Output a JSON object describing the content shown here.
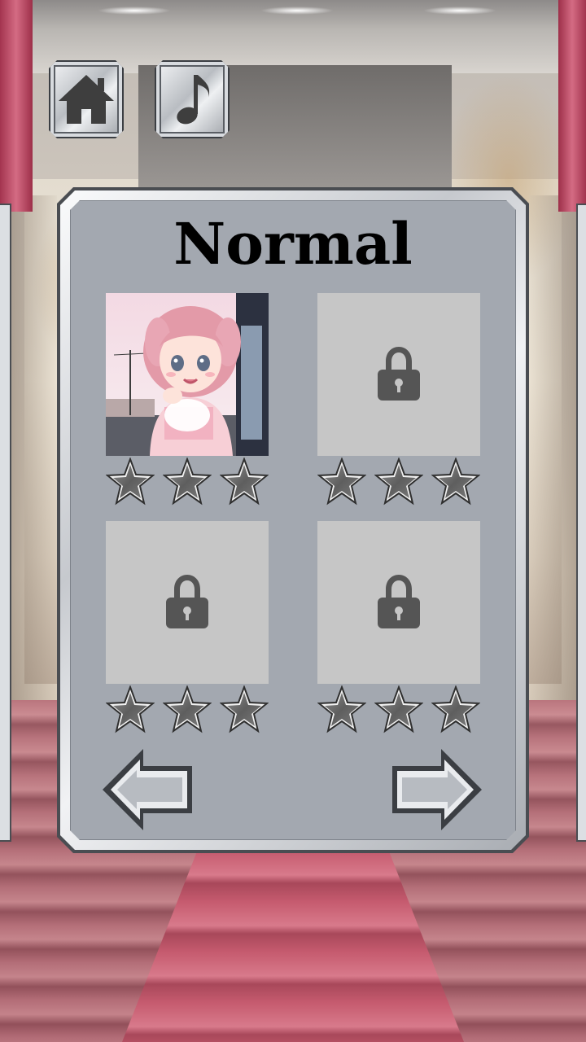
{
  "page": {
    "title": "Normal"
  },
  "toolbar": {
    "home_icon": "home-icon",
    "music_icon": "music-note-icon"
  },
  "levels": [
    {
      "id": 1,
      "status": "unlocked",
      "thumbnail": "anime-girl-portrait",
      "stars_earned": 0,
      "stars_total": 3
    },
    {
      "id": 2,
      "status": "locked",
      "icon": "lock-icon",
      "stars_earned": 0,
      "stars_total": 3
    },
    {
      "id": 3,
      "status": "locked",
      "icon": "lock-icon",
      "stars_earned": 0,
      "stars_total": 3
    },
    {
      "id": 4,
      "status": "locked",
      "icon": "lock-icon",
      "stars_earned": 0,
      "stars_total": 3
    }
  ],
  "navigation": {
    "prev_icon": "arrow-left-icon",
    "next_icon": "arrow-right-icon"
  },
  "colors": {
    "panel_body": "#a3a8b0",
    "locked_tile": "#c6c6c6",
    "lock": "#555555",
    "star_empty": "#6f6f6f",
    "curtain": "#c24a64"
  }
}
